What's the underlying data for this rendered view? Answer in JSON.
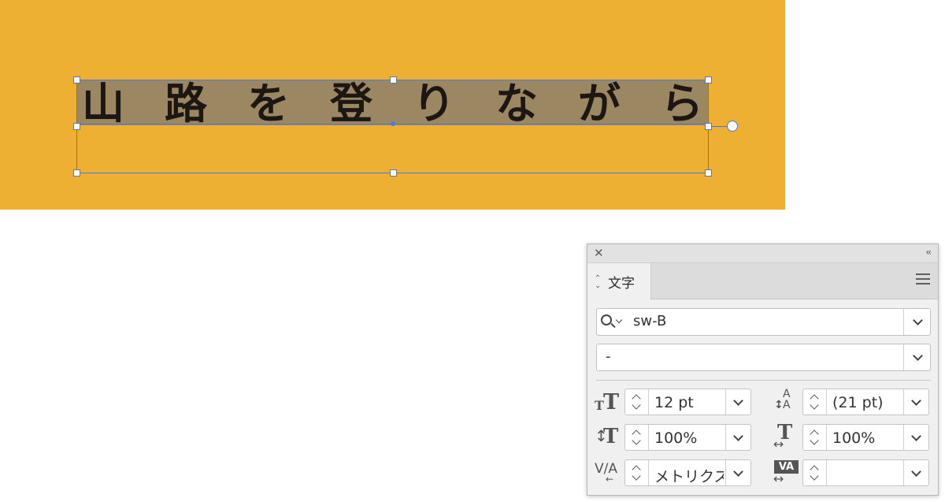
{
  "canvas": {
    "background_color": "#edb032",
    "highlight_color": "#9c8763",
    "selection_color": "#4a78e8",
    "text_glyphs": [
      "山",
      "路",
      "を",
      "登",
      "り",
      "な",
      "が",
      "ら"
    ]
  },
  "panel": {
    "close_icon": "close-icon",
    "collapse_icon": "collapse-icon",
    "tab_label": "文字",
    "menu_icon": "hamburger-menu-icon",
    "font_family": "sw-B",
    "font_style": "-",
    "font_size": "12 pt",
    "leading": "(21 pt)",
    "vertical_scale": "100%",
    "horizontal_scale": "100%",
    "kerning": "メトリクス",
    "tracking": ""
  }
}
